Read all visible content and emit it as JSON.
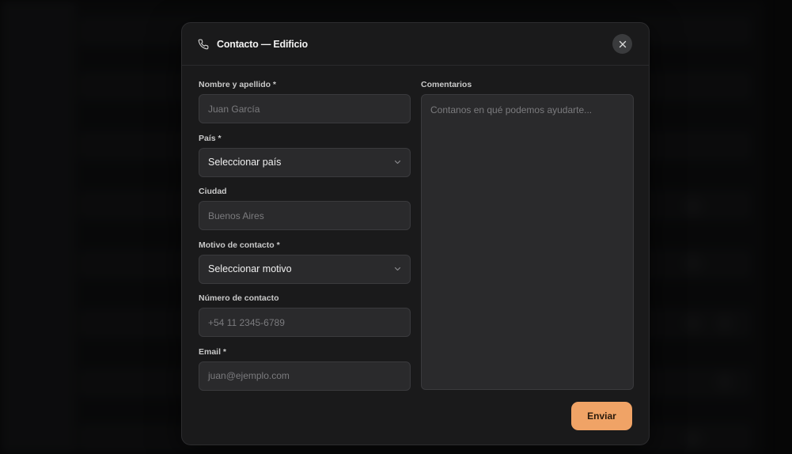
{
  "modal": {
    "title": "Contacto — Edificio",
    "icon": "phone-icon",
    "close_icon": "close-icon"
  },
  "form": {
    "name": {
      "label": "Nombre y apellido *",
      "placeholder": "Juan García"
    },
    "country": {
      "label": "País *",
      "value": "Seleccionar país"
    },
    "city": {
      "label": "Ciudad",
      "placeholder": "Buenos Aires"
    },
    "reason": {
      "label": "Motivo de contacto *",
      "value": "Seleccionar motivo"
    },
    "phone": {
      "label": "Número de contacto",
      "placeholder": "+54 11 2345-6789"
    },
    "email": {
      "label": "Email *",
      "placeholder": "juan@ejemplo.com"
    },
    "comments": {
      "label": "Comentarios",
      "placeholder": "Contanos en qué podemos ayudarte..."
    }
  },
  "actions": {
    "submit_label": "Enviar"
  },
  "colors": {
    "accent": "#f0a366",
    "modal_bg": "#1a1a1b",
    "field_bg": "#2a2a2c"
  }
}
